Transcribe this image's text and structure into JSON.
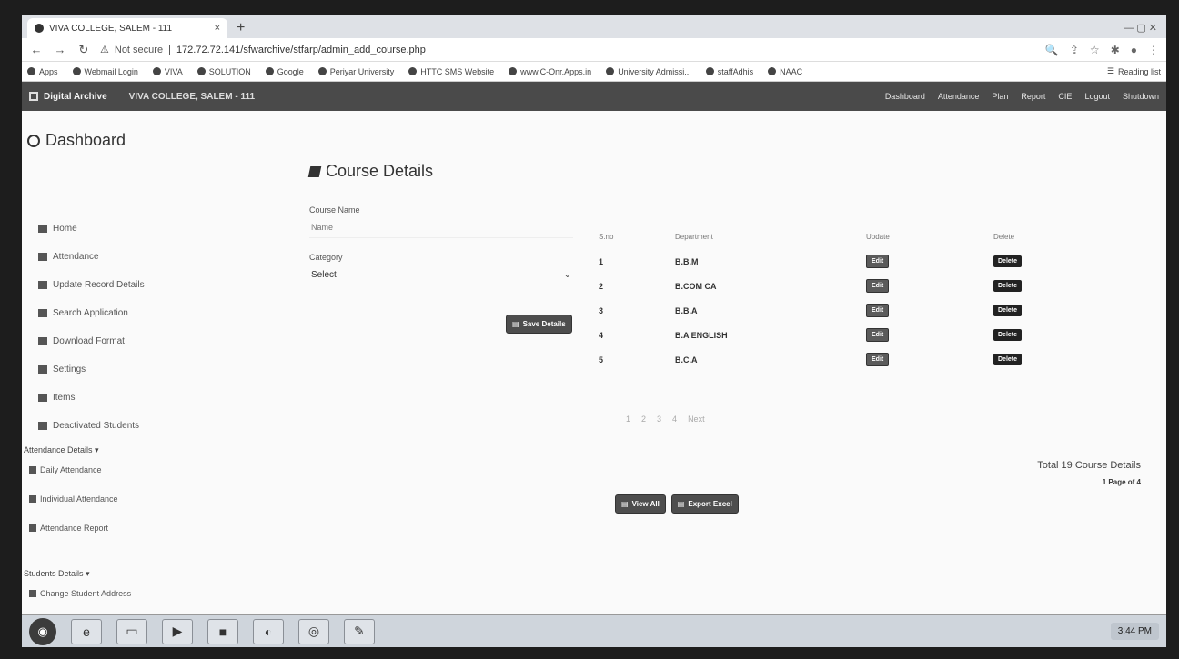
{
  "browser": {
    "tab_title": "VIVA COLLEGE, SALEM - 111",
    "url_status": "Not secure",
    "url": "172.72.72.141/sfwarchive/stfarp/admin_add_course.php",
    "bookmarks": [
      "Apps",
      "Webmail Login",
      "VIVA",
      "SOLUTION",
      "Google",
      "Periyar University",
      "HTTC SMS Website",
      "www.C-Onr.Apps.in",
      "University Admissi...",
      "staffAdhis",
      "NAAC"
    ],
    "reading_list": "Reading list"
  },
  "appnav": {
    "brand": "Digital Archive",
    "college": "VIVA COLLEGE, SALEM - 111",
    "menu": [
      "Dashboard",
      "Attendance",
      "Plan",
      "Report",
      "CIE",
      "Logout",
      "Shutdown"
    ]
  },
  "sidebar": {
    "title": "Dashboard",
    "items": [
      "Home",
      "Attendance",
      "Update Record Details",
      "Search Application",
      "Download Format",
      "Settings",
      "Items",
      "Deactivated Students"
    ],
    "attendance_head": "Attendance Details",
    "attendance_items": [
      "Daily Attendance",
      "Individual Attendance",
      "Attendance Report"
    ],
    "students_head": "Students Details",
    "students_items": [
      "Change Student Address"
    ]
  },
  "main": {
    "title": "Course Details",
    "form": {
      "course_label": "Course Name",
      "course_placeholder": "Name",
      "category_label": "Category",
      "category_value": "Select",
      "save_label": "Save Details"
    },
    "table": {
      "headers": [
        "S.no",
        "Department",
        "Update",
        "Delete"
      ],
      "rows": [
        {
          "sno": "1",
          "dept": "B.B.M",
          "upd": "Edit",
          "del": "Delete"
        },
        {
          "sno": "2",
          "dept": "B.COM CA",
          "upd": "Edit",
          "del": "Delete"
        },
        {
          "sno": "3",
          "dept": "B.B.A",
          "upd": "Edit",
          "del": "Delete"
        },
        {
          "sno": "4",
          "dept": "B.A ENGLISH",
          "upd": "Edit",
          "del": "Delete"
        },
        {
          "sno": "5",
          "dept": "B.C.A",
          "upd": "Edit",
          "del": "Delete"
        }
      ]
    },
    "pager": [
      "1",
      "2",
      "3",
      "4",
      "Next"
    ],
    "total": "Total 19 Course Details",
    "page_of": "1 Page of 4",
    "view_all_label": "View All",
    "export_label": "Export Excel"
  },
  "taskbar": {
    "clock": "3:44 PM"
  }
}
